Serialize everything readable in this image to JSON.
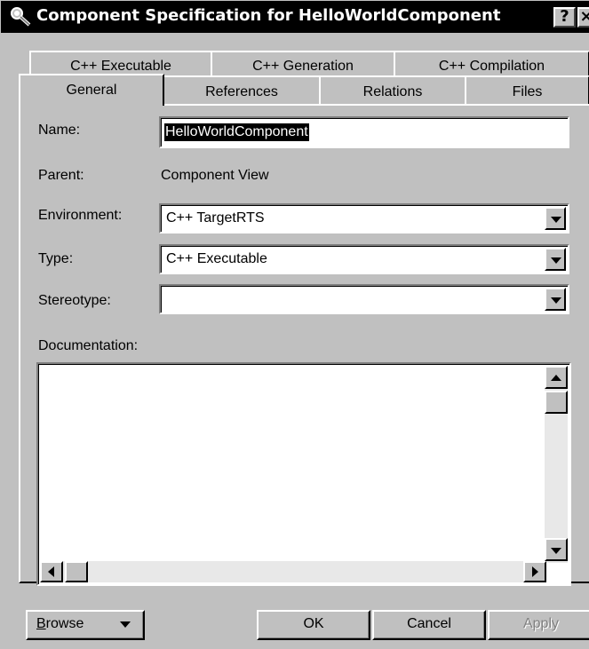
{
  "window": {
    "title": "Component Specification for HelloWorldComponent",
    "help_label": "?",
    "close_label": "×"
  },
  "tabs": {
    "row1": [
      {
        "label": "C++ Executable"
      },
      {
        "label": "C++ Generation"
      },
      {
        "label": "C++ Compilation"
      }
    ],
    "row2": [
      {
        "label": "General",
        "active": true
      },
      {
        "label": "References"
      },
      {
        "label": "Relations"
      },
      {
        "label": "Files"
      }
    ]
  },
  "form": {
    "name_label": "Name:",
    "name_value": "HelloWorldComponent",
    "parent_label": "Parent:",
    "parent_value": "Component View",
    "environment_label": "Environment:",
    "environment_value": "C++ TargetRTS",
    "type_label": "Type:",
    "type_value": "C++ Executable",
    "stereotype_label": "Stereotype:",
    "stereotype_value": "",
    "documentation_label": "Documentation:",
    "documentation_value": ""
  },
  "buttons": {
    "browse_first": "B",
    "browse_rest": "rowse",
    "ok": "OK",
    "cancel": "Cancel",
    "apply": "Apply"
  },
  "colors": {
    "face": "#c0c0c0",
    "titlebar": "#000000",
    "selection": "#000000",
    "disabled_text": "#808080"
  }
}
